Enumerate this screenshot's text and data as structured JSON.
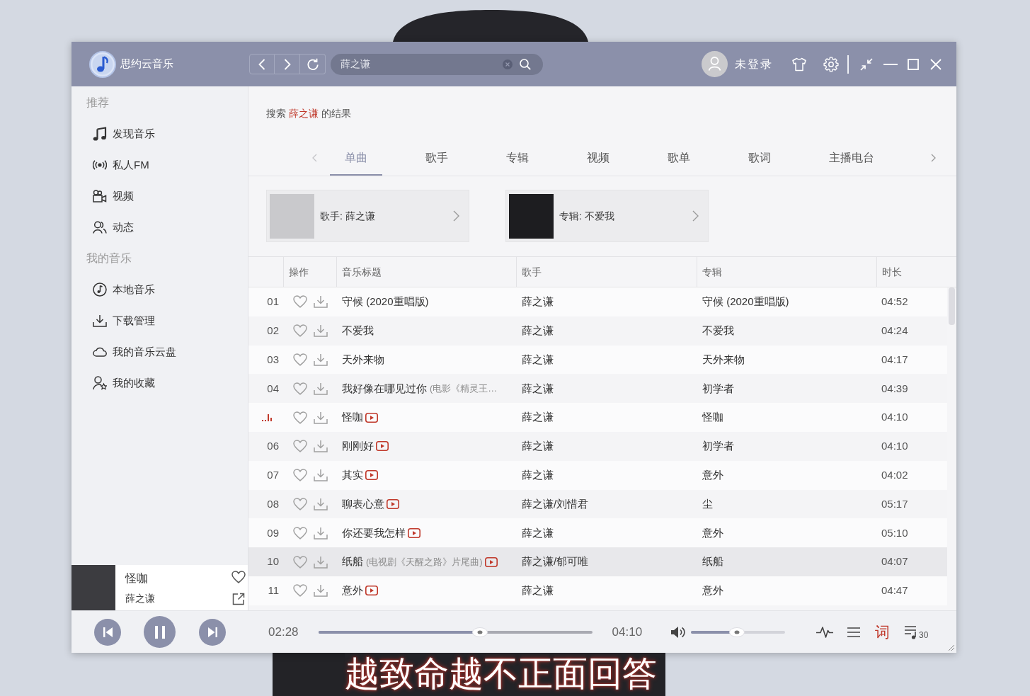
{
  "desktop": {
    "lyrics": "越致命越不正面回答"
  },
  "window": {
    "app_name": "思约云音乐",
    "search": {
      "value": "薛之谦"
    },
    "account": {
      "label": "未登录"
    }
  },
  "sidebar": {
    "sections": [
      {
        "heading": "推荐",
        "items": [
          {
            "label": "发现音乐",
            "selected": false
          },
          {
            "label": "私人FM",
            "selected": false
          },
          {
            "label": "视频",
            "selected": false
          },
          {
            "label": "动态",
            "selected": false
          }
        ]
      },
      {
        "heading": "我的音乐",
        "items": [
          {
            "label": "本地音乐",
            "selected": false
          },
          {
            "label": "下载管理",
            "selected": false
          },
          {
            "label": "我的音乐云盘",
            "selected": false
          },
          {
            "label": "我的收藏",
            "selected": false
          }
        ]
      }
    ],
    "now_playing": {
      "title": "怪咖",
      "artist": "薛之谦"
    }
  },
  "search_summary": {
    "prefix": "搜索",
    "keyword": "薛之谦",
    "suffix": "的结果"
  },
  "tabs": [
    {
      "label": "单曲",
      "selected": true
    },
    {
      "label": "歌手",
      "selected": false
    },
    {
      "label": "专辑",
      "selected": false
    },
    {
      "label": "视频",
      "selected": false
    },
    {
      "label": "歌单",
      "selected": false
    },
    {
      "label": "歌词",
      "selected": false
    },
    {
      "label": "主播电台",
      "selected": false
    }
  ],
  "result_cards": [
    {
      "label": "歌手: 薛之谦"
    },
    {
      "label": "专辑: 不爱我"
    }
  ],
  "table": {
    "columns": [
      "操作",
      "音乐标题",
      "歌手",
      "专辑",
      "时长"
    ],
    "rows": [
      {
        "number": "01",
        "playing": false,
        "title": "守候 (2020重唱版)",
        "mv": false,
        "artist": "薛之谦",
        "album": "守候 (2020重唱版)",
        "duration": "04:52",
        "selected": false
      },
      {
        "number": "02",
        "playing": false,
        "title": "不爱我",
        "mv": false,
        "artist": "薛之谦",
        "album": "不爱我",
        "duration": "04:24",
        "selected": false
      },
      {
        "number": "03",
        "playing": false,
        "title": "天外来物",
        "mv": false,
        "artist": "薛之谦",
        "album": "天外来物",
        "duration": "04:17",
        "selected": false
      },
      {
        "number": "04",
        "playing": false,
        "title": "我好像在哪见过你",
        "subtitle": "(电影《精灵王…",
        "mv": false,
        "artist": "薛之谦",
        "album": "初学者",
        "duration": "04:39",
        "selected": false
      },
      {
        "playing": true,
        "title": "怪咖",
        "mv": true,
        "artist": "薛之谦",
        "album": "怪咖",
        "duration": "04:10",
        "selected": false
      },
      {
        "number": "06",
        "playing": false,
        "title": "刚刚好",
        "mv": true,
        "artist": "薛之谦",
        "album": "初学者",
        "duration": "04:10",
        "selected": false
      },
      {
        "number": "07",
        "playing": false,
        "title": "其实",
        "mv": true,
        "artist": "薛之谦",
        "album": "意外",
        "duration": "04:02",
        "selected": false
      },
      {
        "number": "08",
        "playing": false,
        "title": "聊表心意",
        "mv": true,
        "artist": "薛之谦/刘惜君",
        "album": "尘",
        "duration": "05:17",
        "selected": false
      },
      {
        "number": "09",
        "playing": false,
        "title": "你还要我怎样",
        "mv": true,
        "artist": "薛之谦",
        "album": "意外",
        "duration": "05:10",
        "selected": false
      },
      {
        "number": "10",
        "playing": false,
        "title": "纸船",
        "subtitle": "(电视剧《天醒之路》片尾曲)",
        "mv": true,
        "artist": "薛之谦/郁可唯",
        "album": "纸船",
        "duration": "04:07",
        "selected": true
      },
      {
        "number": "11",
        "playing": false,
        "title": "意外",
        "mv": true,
        "artist": "薛之谦",
        "album": "意外",
        "duration": "04:47",
        "selected": false
      }
    ]
  },
  "player": {
    "playing": true,
    "elapsed": "02:28",
    "progress": {
      "level": 0.59
    },
    "total": "04:10",
    "volume": {
      "level": 0.49
    },
    "lyrics_button": {
      "label": "词",
      "on": true
    },
    "playlist_count": "30"
  }
}
